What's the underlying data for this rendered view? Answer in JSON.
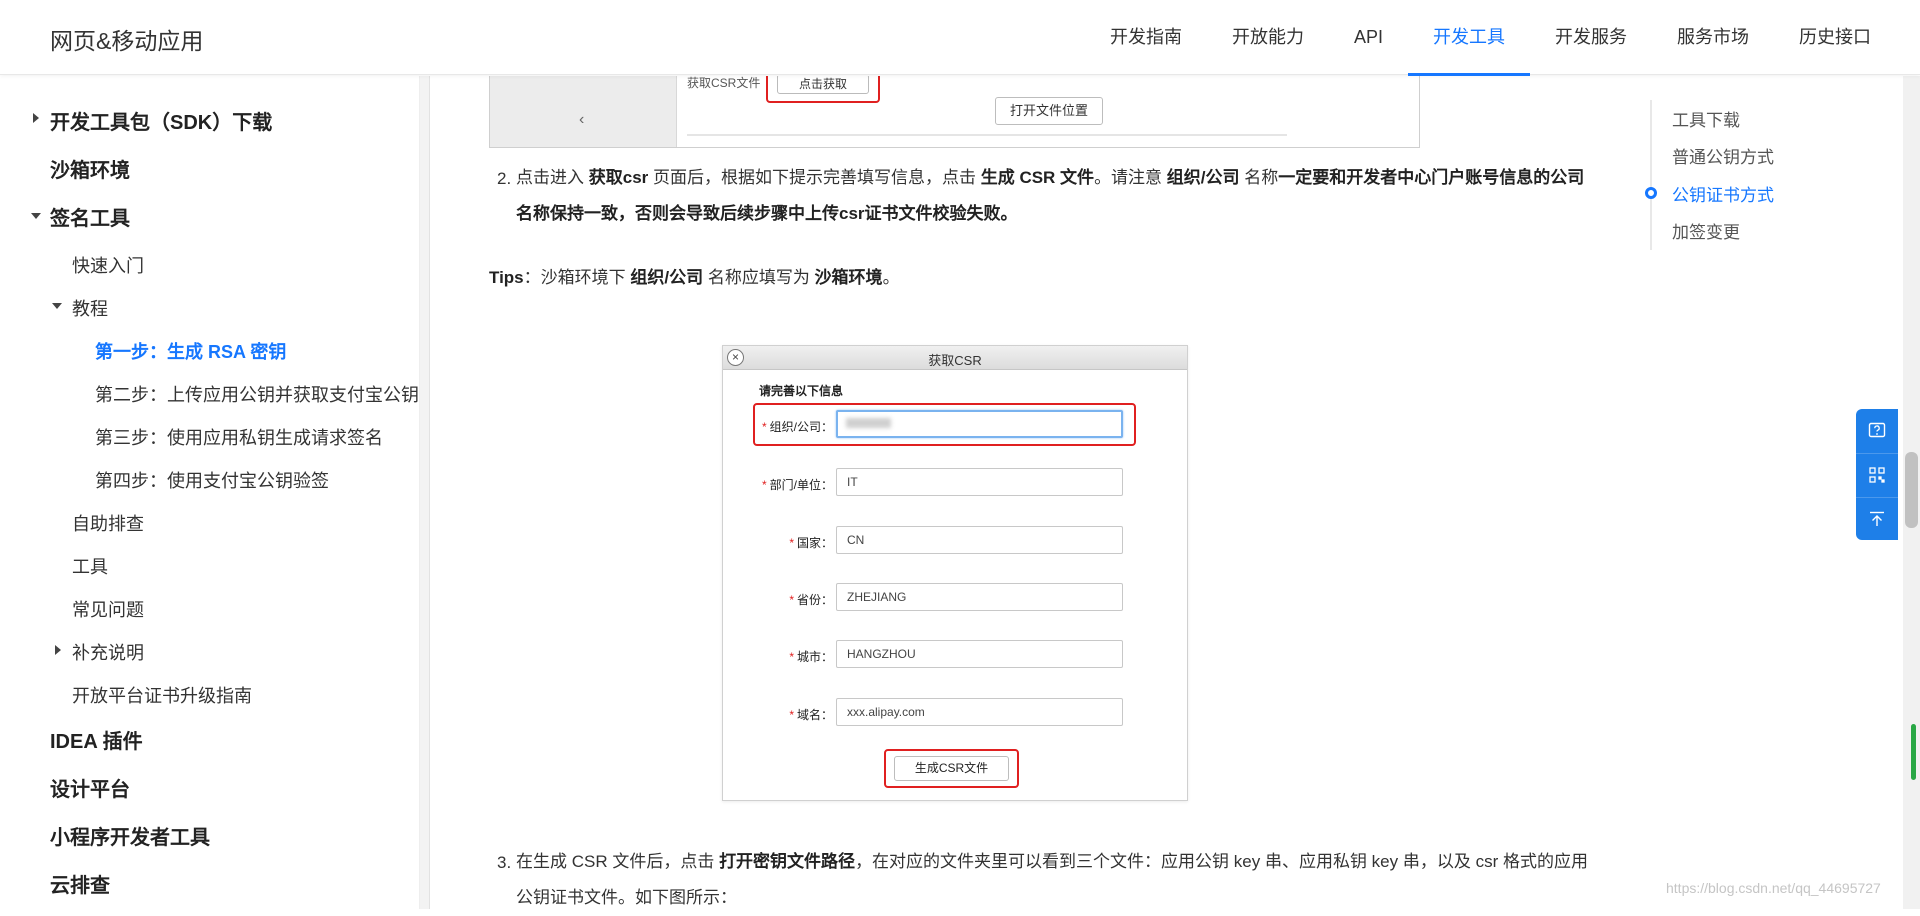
{
  "header": {
    "brand": "网页&移动应用",
    "nav": [
      "开发指南",
      "开放能力",
      "API",
      "开发工具",
      "开发服务",
      "服务市场",
      "历史接口"
    ],
    "active_nav": "开发工具"
  },
  "sidebar": {
    "items": [
      {
        "label": "开发工具包（SDK）下载",
        "arrow": "right"
      },
      {
        "label": "沙箱环境"
      },
      {
        "label": "签名工具",
        "arrow": "down"
      },
      {
        "label": "快速入门"
      },
      {
        "label": "教程",
        "arrow": "down"
      },
      {
        "label": "第一步：生成 RSA 密钥",
        "current": true
      },
      {
        "label": "第二步：上传应用公钥并获取支付宝公钥"
      },
      {
        "label": "第三步：使用应用私钥生成请求签名"
      },
      {
        "label": "第四步：使用支付宝公钥验签"
      },
      {
        "label": "自助排查"
      },
      {
        "label": "工具"
      },
      {
        "label": "常见问题"
      },
      {
        "label": "补充说明",
        "arrow": "right"
      },
      {
        "label": "开放平台证书升级指南"
      },
      {
        "label": "IDEA 插件"
      },
      {
        "label": "设计平台"
      },
      {
        "label": "小程序开发者工具"
      },
      {
        "label": "云排查"
      }
    ]
  },
  "content": {
    "image1": {
      "partial_label": "获取CSR文件",
      "get_button": "点击获取",
      "open_location_button": "打开文件位置",
      "back_arrow": "‹"
    },
    "step2": {
      "number": "2.",
      "t1": "点击进入 ",
      "b1": "获取csr",
      "t2": " 页面后，根据如下提示完善填写信息，点击 ",
      "b2": "生成 CSR 文件",
      "t3": "。请注意 ",
      "b3": "组织/公司",
      "t4": " 名称",
      "b4": "一定要和开发者中心门户账号信息的公司名称保持一致，否则会导致后续步骤中上传csr证书文件校验失败。"
    },
    "tips": {
      "label": "Tips",
      "t1": "：沙箱环境下 ",
      "b1": "组织/公司",
      "t2": " 名称应填写为 ",
      "b2": "沙箱环境",
      "t3": "。"
    },
    "csr_dialog": {
      "title": "获取CSR",
      "close": "×",
      "heading": "请完善以下信息",
      "fields": [
        {
          "label": "组织/公司：",
          "value": ""
        },
        {
          "label": "部门/单位：",
          "value": "IT"
        },
        {
          "label": "国家：",
          "value": "CN"
        },
        {
          "label": "省份：",
          "value": "ZHEJIANG"
        },
        {
          "label": "城市：",
          "value": "HANGZHOU"
        },
        {
          "label": "域名：",
          "value": "xxx.alipay.com"
        }
      ],
      "required_mark": "*",
      "generate_button": "生成CSR文件"
    },
    "step3": {
      "number": "3.",
      "t1": "在生成 CSR 文件后，点击 ",
      "b1": "打开密钥文件路径",
      "t2": "，在对应的文件夹里可以看到三个文件：应用公钥 key 串、应用私钥 key 串，以及 csr 格式的应用公钥证书文件。如下图所示："
    }
  },
  "toc": {
    "items": [
      "工具下载",
      "普通公钥方式",
      "公钥证书方式",
      "加签变更"
    ],
    "active": "公钥证书方式"
  },
  "watermark": "https://blog.csdn.net/qq_44695727"
}
